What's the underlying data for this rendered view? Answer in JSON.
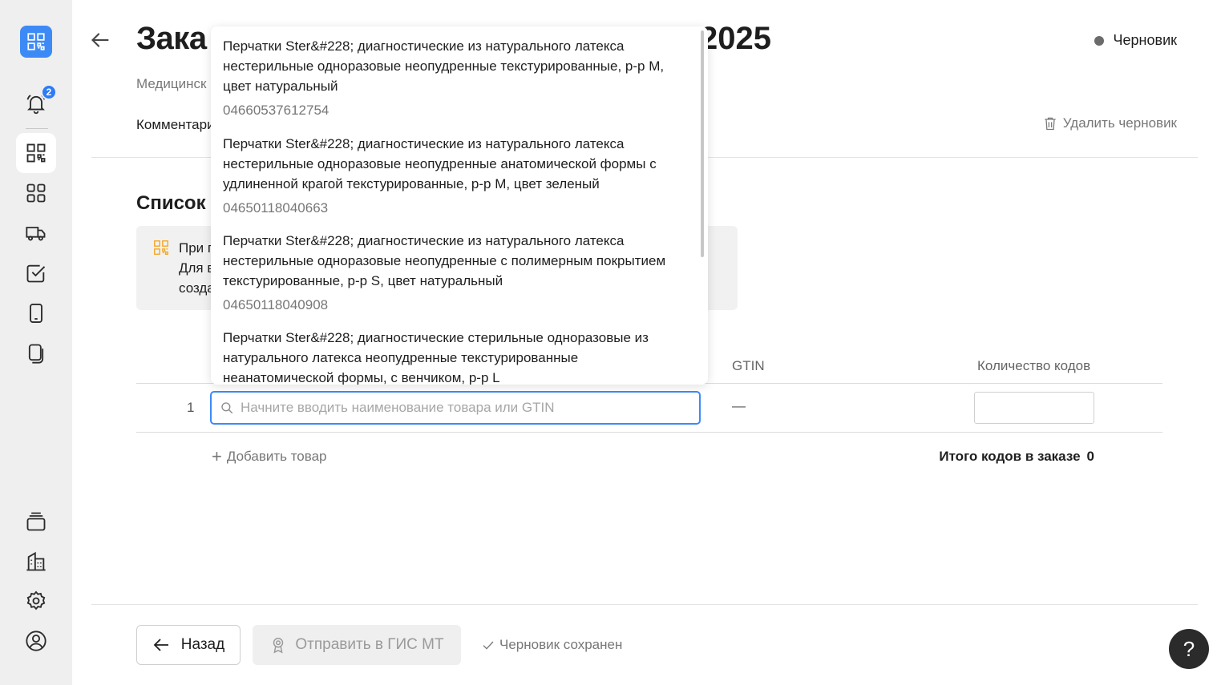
{
  "sidebar": {
    "notification_count": "2",
    "items": [
      {
        "name": "codes"
      },
      {
        "name": "catalog"
      },
      {
        "name": "delivery"
      },
      {
        "name": "tasks"
      },
      {
        "name": "device"
      },
      {
        "name": "documents"
      },
      {
        "name": "stack"
      },
      {
        "name": "organization"
      },
      {
        "name": "settings"
      },
      {
        "name": "profile"
      }
    ]
  },
  "header": {
    "title_start": "Зака",
    "title_end": "2025",
    "status": "Черновик",
    "subtitle": "Медицинск",
    "comment_label": "Комментари",
    "delete_draft": "Удалить черновик"
  },
  "section": {
    "title": "Список",
    "info_lines": [
      "При п",
      "Для в",
      "созда"
    ]
  },
  "table": {
    "col_gtin": "GTIN",
    "col_count": "Количество кодов",
    "rows": [
      {
        "num": "1",
        "gtin": "—",
        "count": ""
      }
    ],
    "search_placeholder": "Начните вводить наименование товара или GTIN",
    "add_product": "Добавить товар",
    "total_label": "Итого кодов в заказе",
    "total_value": "0"
  },
  "dropdown": {
    "items": [
      {
        "name": "Перчатки Ster&#228; диагностические из натурального латекса нестерильные одноразовые неопудренные текстурированные, р-р M, цвет натуральный",
        "gtin": "04660537612754"
      },
      {
        "name": "Перчатки Ster&#228; диагностические из натурального латекса нестерильные одноразовые неопудренные анатомической формы с удлиненной крагой текстурированные, р-р M, цвет зеленый",
        "gtin": "04650118040663"
      },
      {
        "name": "Перчатки Ster&#228; диагностические из натурального латекса нестерильные одноразовые неопудренные с полимерным покрытием текстурированные, р-р S, цвет натуральный",
        "gtin": "04650118040908"
      },
      {
        "name": "Перчатки Ster&#228; диагностические стерильные одноразовые из натурального латекса неопудренные текстурированные неанатомической формы, с венчиком, р-р L",
        "gtin": ""
      }
    ]
  },
  "footer": {
    "back": "Назад",
    "send": "Отправить в ГИС МТ",
    "saved": "Черновик сохранен",
    "help": "?"
  },
  "colors": {
    "accent": "#3d8af7",
    "warning_icon": "#f5a623",
    "sidebar_bg": "#efefef"
  }
}
